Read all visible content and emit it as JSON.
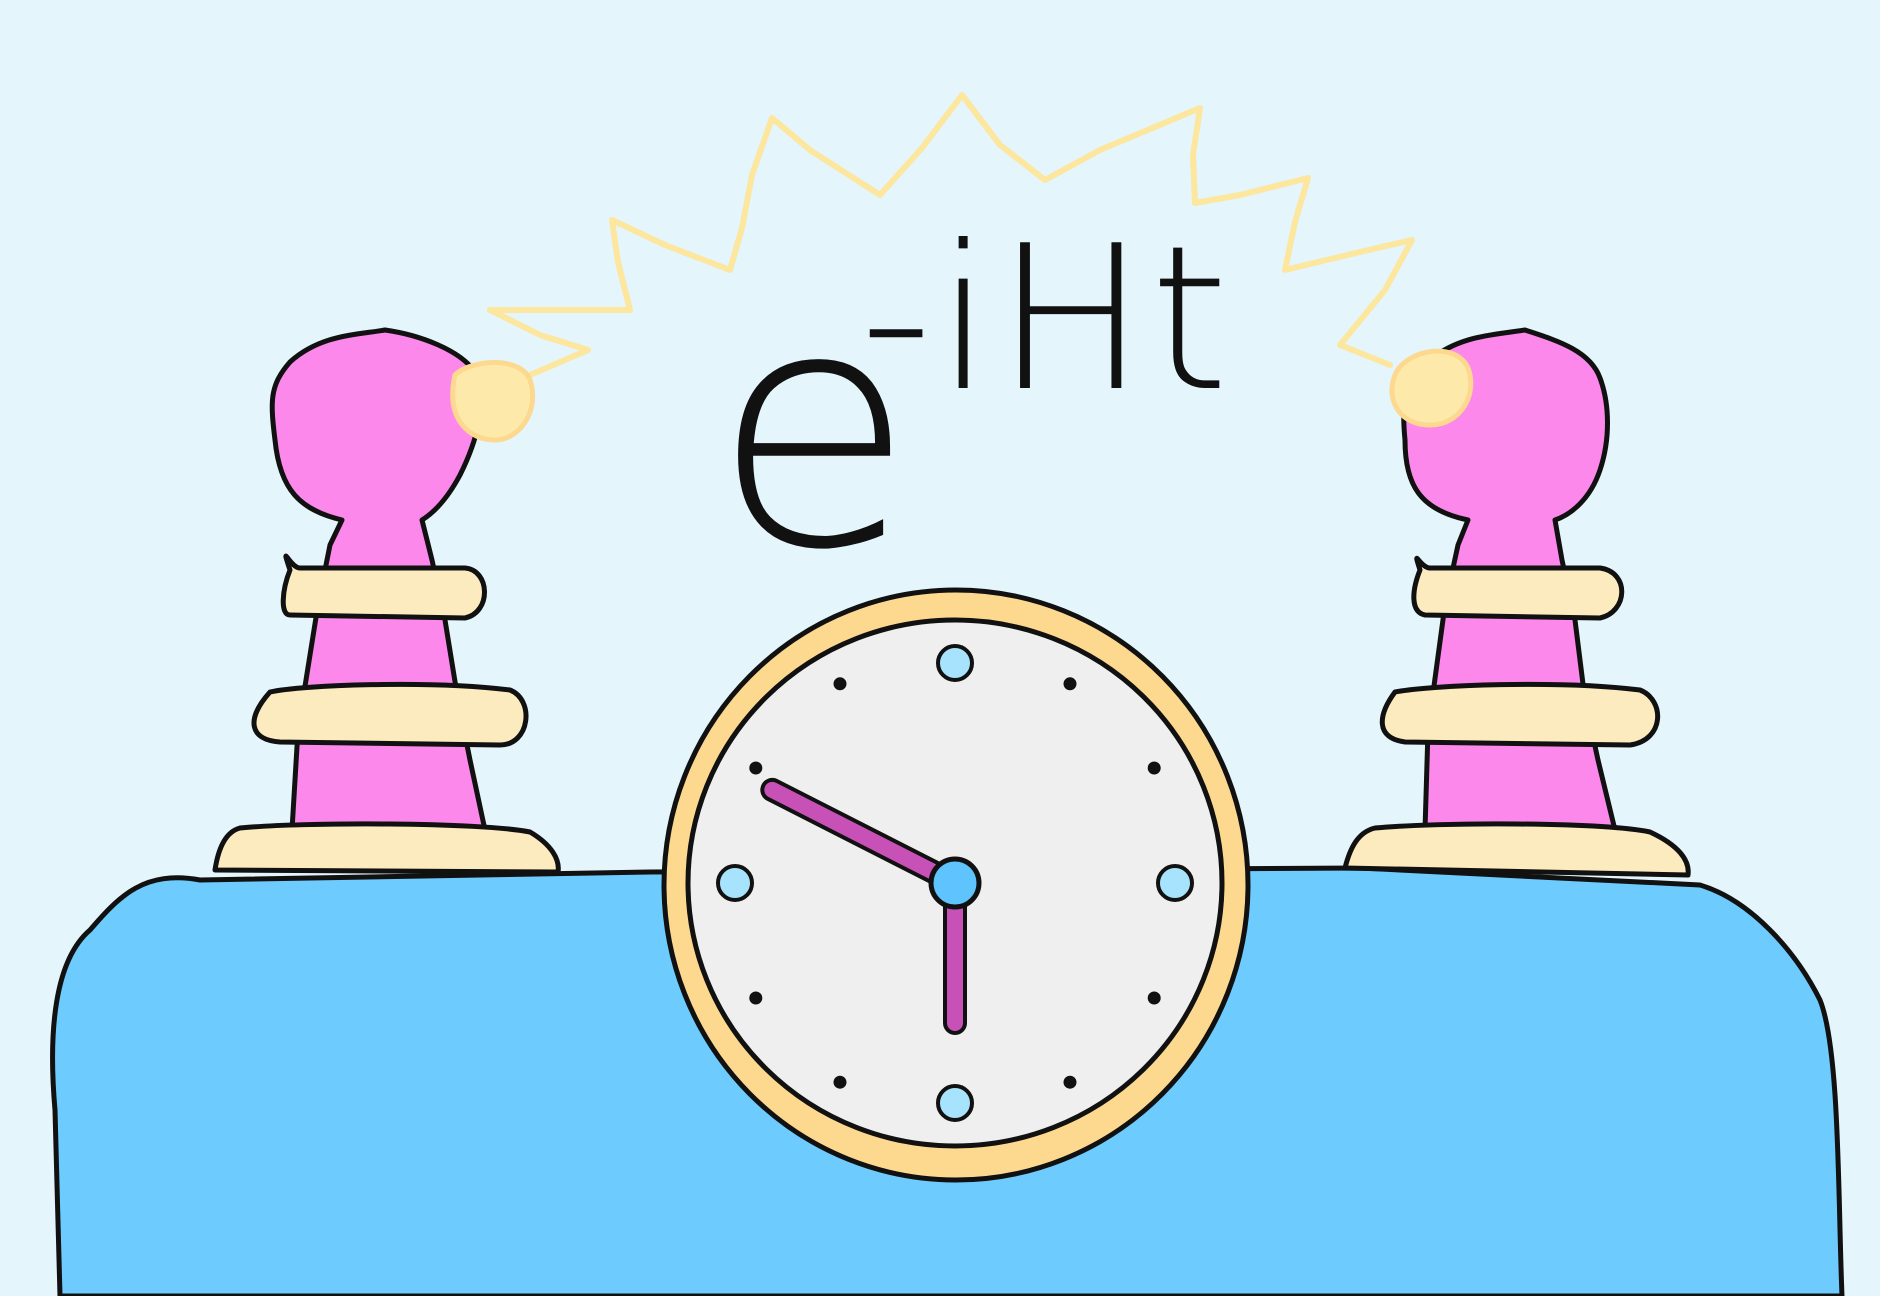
{
  "formula": {
    "base": "e",
    "exponent": "-iHt"
  },
  "clock": {
    "hour_hand_points_to": 9.9,
    "minute_hand_points_to": 6
  },
  "colors": {
    "background": "#e4f5fc",
    "table": "#6ecbfd",
    "pedestal_body": "#fd88eb",
    "pedestal_rings": "#fdebc0",
    "spark": "#fde69e",
    "clock_rim": "#fdd990",
    "clock_face": "#f0efef",
    "hands": "#c851b7",
    "markers": "#a7e3fc",
    "outline": "#111111"
  }
}
